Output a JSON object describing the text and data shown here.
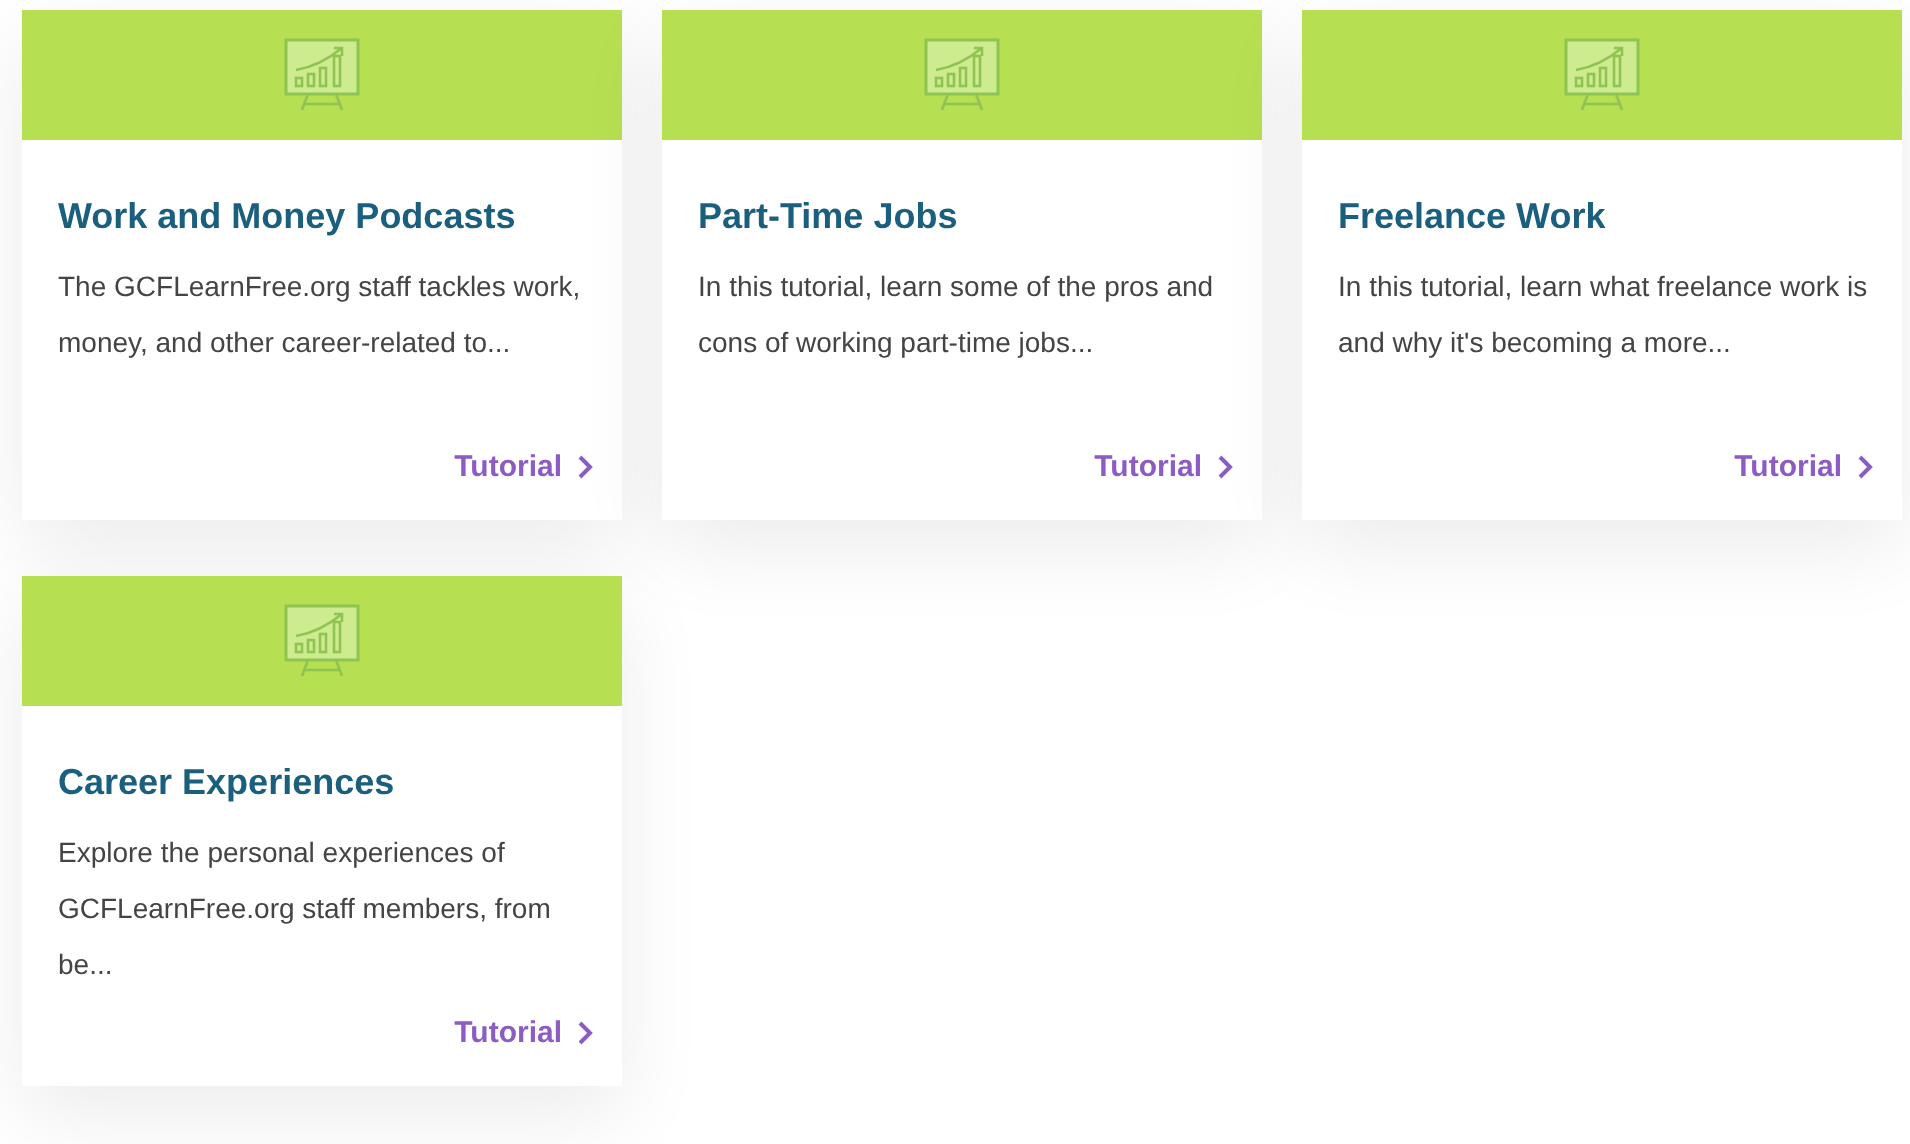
{
  "cards": [
    {
      "title": "Work and Money Podcasts",
      "description": "The GCFLearnFree.org staff tackles work, money, and other career-related to...",
      "link": "Tutorial"
    },
    {
      "title": "Part-Time Jobs",
      "description": "In this tutorial, learn some of the pros and cons of working part-time jobs...",
      "link": "Tutorial"
    },
    {
      "title": "Freelance Work",
      "description": "In this tutorial, learn what freelance work is and why it's becoming a more...",
      "link": "Tutorial"
    },
    {
      "title": "Career Experiences",
      "description": "Explore the personal experiences of GCFLearnFree.org staff members, from be...",
      "link": "Tutorial"
    }
  ]
}
